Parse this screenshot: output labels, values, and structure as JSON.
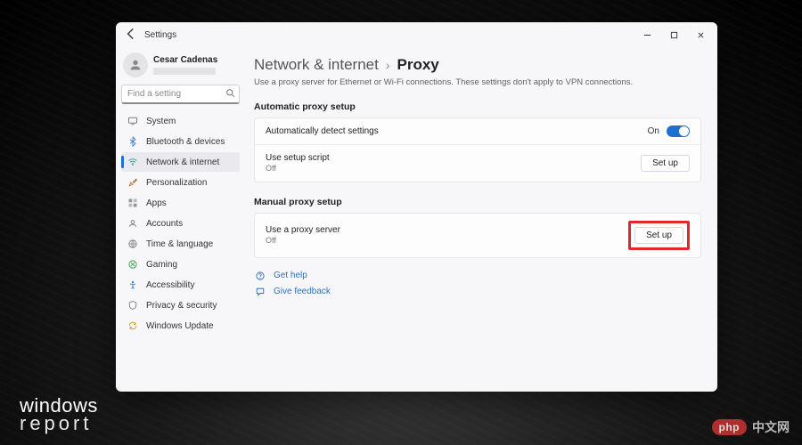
{
  "window": {
    "title": "Settings",
    "controls": {
      "minimize": "minimize",
      "maximize": "maximize",
      "close": "close"
    }
  },
  "user": {
    "name": "Cesar Cadenas"
  },
  "search": {
    "placeholder": "Find a setting"
  },
  "sidebar": {
    "items": [
      {
        "label": "System"
      },
      {
        "label": "Bluetooth & devices"
      },
      {
        "label": "Network & internet"
      },
      {
        "label": "Personalization"
      },
      {
        "label": "Apps"
      },
      {
        "label": "Accounts"
      },
      {
        "label": "Time & language"
      },
      {
        "label": "Gaming"
      },
      {
        "label": "Accessibility"
      },
      {
        "label": "Privacy & security"
      },
      {
        "label": "Windows Update"
      }
    ]
  },
  "breadcrumb": {
    "parent": "Network & internet",
    "current": "Proxy"
  },
  "description": "Use a proxy server for Ethernet or Wi-Fi connections. These settings don't apply to VPN connections.",
  "sections": {
    "auto": {
      "title": "Automatic proxy setup",
      "rows": [
        {
          "label": "Automatically detect settings",
          "state": "On",
          "kind": "toggle"
        },
        {
          "label": "Use setup script",
          "sub": "Off",
          "action": "Set up",
          "kind": "button"
        }
      ]
    },
    "manual": {
      "title": "Manual proxy setup",
      "rows": [
        {
          "label": "Use a proxy server",
          "sub": "Off",
          "action": "Set up",
          "kind": "button"
        }
      ]
    }
  },
  "help": {
    "get_help": "Get help",
    "feedback": "Give feedback"
  },
  "watermark_left": {
    "line1": "windows",
    "line2": "report"
  },
  "watermark_right": {
    "badge": "php",
    "text": "中文网"
  }
}
